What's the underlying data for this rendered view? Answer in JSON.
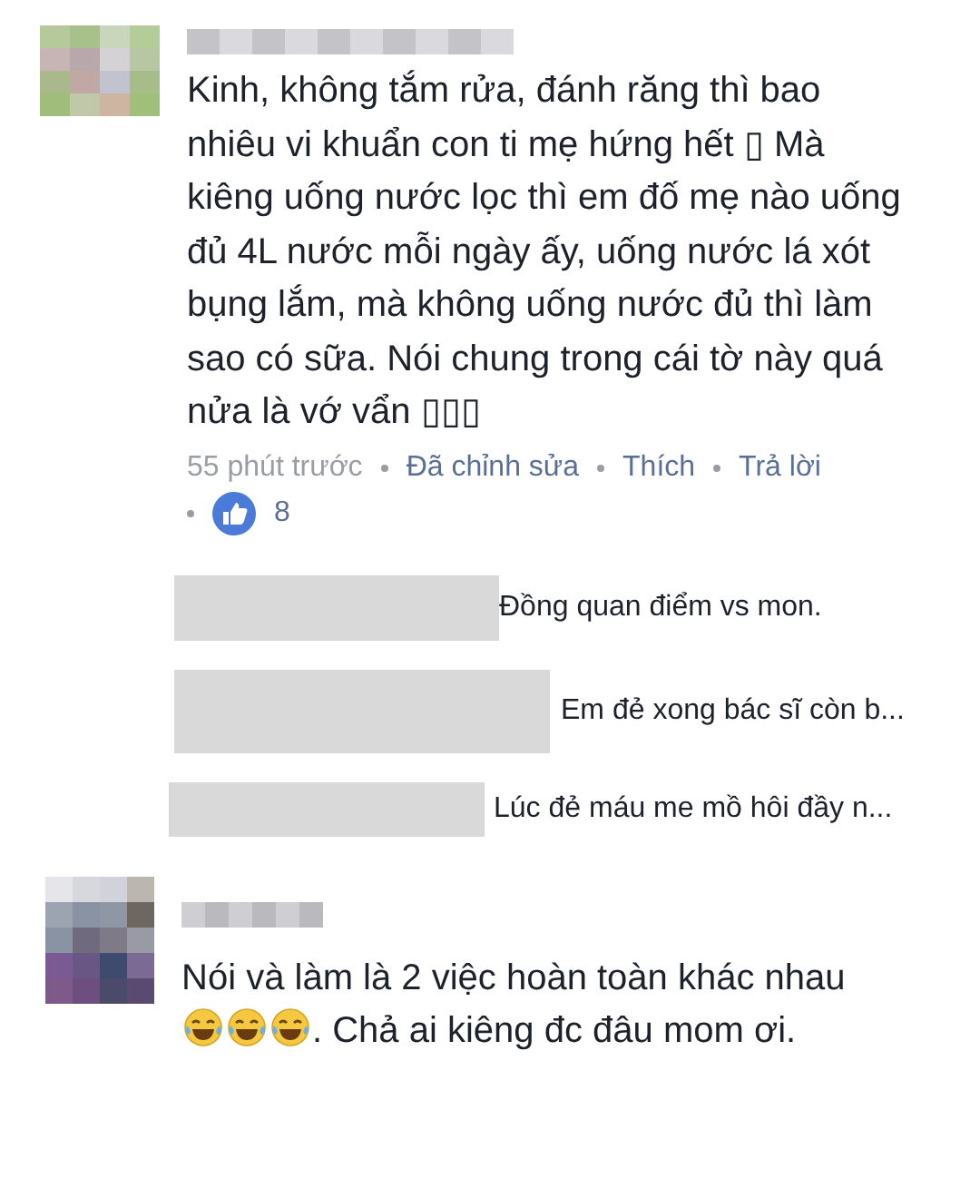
{
  "comments": [
    {
      "text": "Kinh, không tắm rửa, đánh răng thì bao nhiêu vi khuẩn con ti mẹ hứng hết ▯ Mà kiêng uống nước lọc thì em đố mẹ nào uống đủ 4L nước mỗi ngày ấy, uống nước lá xót bụng lắm, mà không uống nước đủ thì làm sao có sữa. Nói chung trong cái tờ này quá nửa là vớ vẩn ▯▯▯",
      "time": "55 phút trước",
      "edited": "Đã chỉnh sửa",
      "actions": [
        "Thích",
        "Trả lời"
      ],
      "likes": "8",
      "replies": [
        {
          "text": "Đồng quan điểm vs mon."
        },
        {
          "text": "Em đẻ xong bác sĩ còn b..."
        },
        {
          "text": "Lúc đẻ máu me mồ hôi đầy n..."
        }
      ]
    },
    {
      "text_before": "Nói và làm là 2 việc hoàn toàn khác nhau",
      "emojis": [
        {
          "kind": "laughing_tears"
        },
        {
          "kind": "laughing_tears"
        },
        {
          "kind": "laughing_tears"
        }
      ],
      "text_after": ". Chả ai kiêng đc đâu mom ơi."
    }
  ]
}
